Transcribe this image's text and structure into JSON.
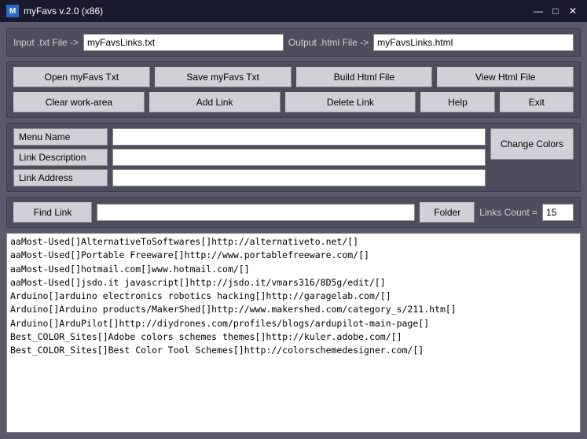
{
  "titleBar": {
    "title": "myFavs v.2.0 (x86)",
    "minimize": "—",
    "maximize": "□",
    "close": "✕"
  },
  "fileRow": {
    "inputLabel": "Input .txt File ->",
    "inputValue": "myFavsLinks.txt",
    "outputLabel": "Output .html File ->",
    "outputValue": "myFavsLinks.html"
  },
  "buttons": {
    "openMyFavsTxt": "Open myFavs Txt",
    "saveMyFavsTxt": "Save myFavs Txt",
    "buildHtmlFile": "Build Html File",
    "viewHtmlFile": "View Html File",
    "clearWorkArea": "Clear work-area",
    "addLink": "Add Link",
    "deleteLink": "Delete Link",
    "help": "Help",
    "exit": "Exit",
    "changeColors": "Change Colors",
    "findLink": "Find Link",
    "folder": "Folder"
  },
  "formFields": {
    "menuName": "Menu Name",
    "linkDescription": "Link Description",
    "linkAddress": "Link Address"
  },
  "bottomBar": {
    "linksCountLabel": "Links Count =",
    "linksCountValue": "15"
  },
  "listItems": [
    "aaMost-Used[]AlternativeToSoftwares[]http://alternativeto.net/[]",
    "aaMost-Used[]Portable Freeware[]http://www.portablefreeware.com/[]",
    "aaMost-Used[]hotmail.com[]www.hotmail.com/[]",
    "aaMost-Used[]jsdo.it javascript[]http://jsdo.it/vmars316/8D5g/edit/[]",
    "Arduino[]arduino electronics robotics hacking[]http://garagelab.com/[]",
    "Arduino[]Arduino products/MakerShed[]http://www.makershed.com/category_s/211.htm[]",
    "Arduino[]ArduPilot[]http://diydrones.com/profiles/blogs/ardupilot-main-page[]",
    "Best_COLOR_Sites[]Adobe colors schemes themes[]http://kuler.adobe.com/[]",
    "Best_COLOR_Sites[]Best Color Tool Schemes[]http://colorschemedesigner.com/[]"
  ]
}
